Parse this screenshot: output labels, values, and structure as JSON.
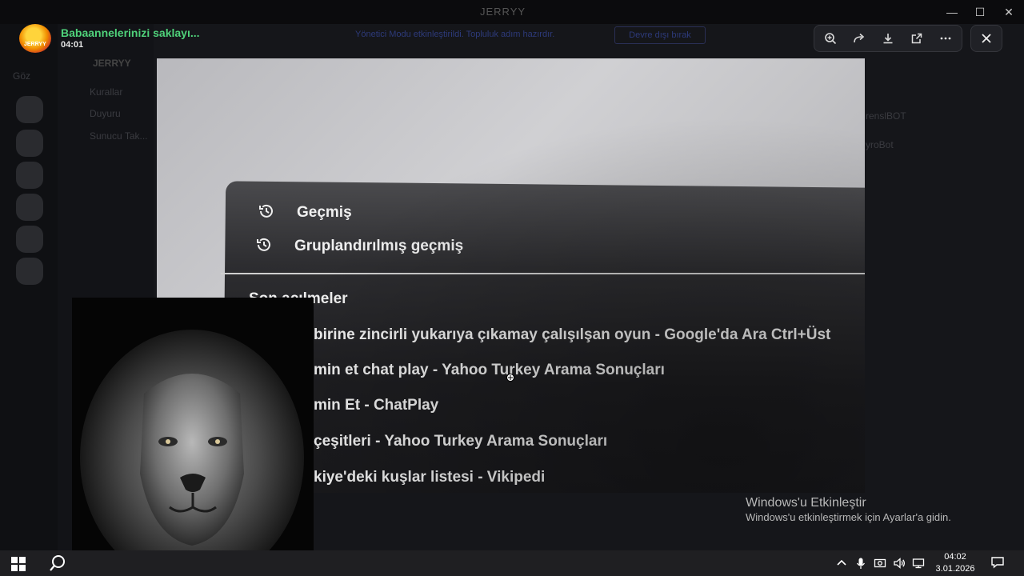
{
  "os_window": {
    "title": "JERRYY",
    "minimize_glyph": "—",
    "maximize_glyph": "☐",
    "close_glyph": "✕"
  },
  "viewer": {
    "file_name": "Babaannelerinizi saklayı...",
    "duration": "04:01",
    "avatar_badge": "JERRYY",
    "notice_text": "Yönetici Modu etkinleştirildi. Topluluk adım hazırdır.",
    "notice_button": "Devre dışı bırak",
    "toolbar": {
      "icons": [
        "zoom-icon",
        "forward-icon",
        "download-icon",
        "open-external-icon",
        "more-icon"
      ]
    },
    "close_icon": "close-icon"
  },
  "background_app": {
    "server_name": "JERRYY",
    "server_label": "Göz",
    "channels": [
      "Kurallar",
      "Duyuru",
      "Sunucu Tak..."
    ],
    "members": [
      "renslBOT",
      "yroBot"
    ]
  },
  "photo": {
    "menu_items": [
      {
        "icon": "history-icon",
        "label": "Geçmiş"
      },
      {
        "icon": "history-icon",
        "label": "Gruplandırılmış geçmiş"
      }
    ],
    "section_header": "Son açılmeler",
    "recent": [
      "birine zincirli yukarıya çıkamay çalışılşan oyun - Google'da Ara  Ctrl+Üst",
      "min et chat play - Yahoo Turkey Arama Sonuçları",
      "min Et - ChatPlay",
      "çeşitleri - Yahoo Turkey Arama Sonuçları",
      "kiye'deki kuşlar listesi - Vikipedi"
    ]
  },
  "activation": {
    "title": "Windows'u Etkinleştir",
    "subtitle": "Windows'u etkinleştirmek için Ayarlar'a gidin."
  },
  "taskbar": {
    "time": "04:02",
    "date": "3.01.2026",
    "tray_icons": [
      "chevron-up-icon",
      "microphone-icon",
      "camera-icon",
      "volume-icon",
      "network-icon"
    ]
  },
  "colors": {
    "accent_green": "#4fd27a",
    "toolbar_bg": "#202126",
    "taskbar_bg": "#1f1f22"
  }
}
